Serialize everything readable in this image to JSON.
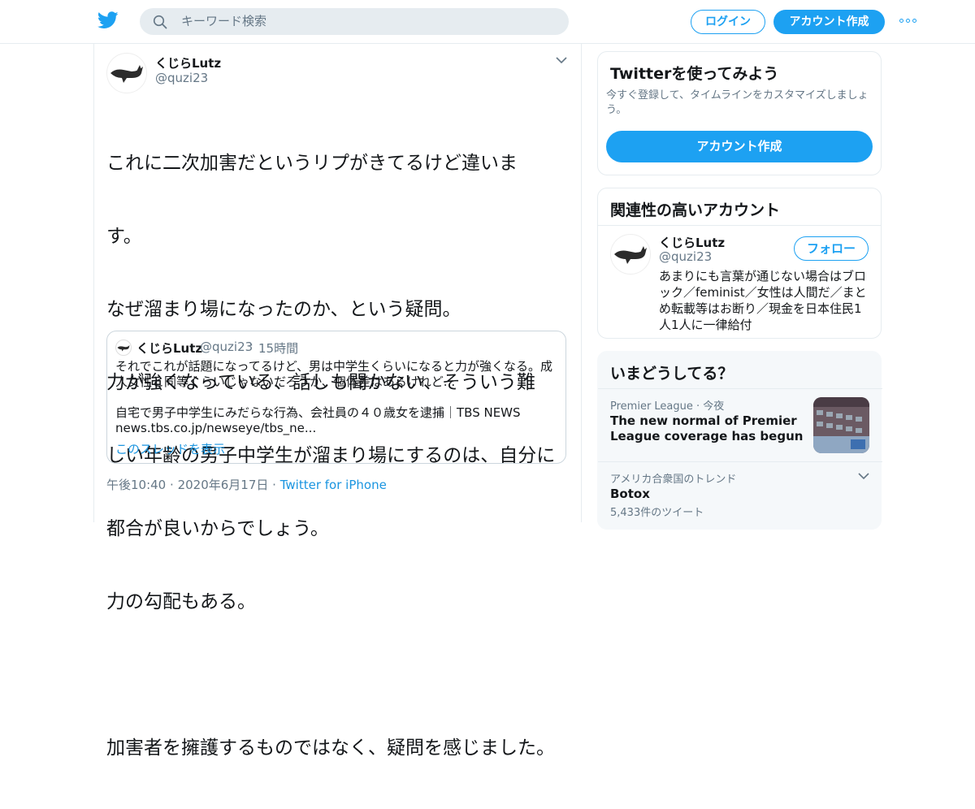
{
  "header": {
    "search_placeholder": "キーワード検索",
    "login_label": "ログイン",
    "signup_label": "アカウント作成"
  },
  "colors": {
    "brand_blue": "#1da1f2",
    "link_blue": "#1b95e0",
    "secondary_text": "#657786",
    "border": "#e6ecf0"
  },
  "tweet": {
    "author_name": "くじらLutz",
    "author_handle": "@quzi23",
    "text_lines": [
      "これに二次加害だというリプがきてるけど違いま",
      "す。",
      "なぜ溜まり場になったのか、という疑問。",
      "力が強くなっている、話しも聞かない、そういう難",
      "しい年齢の男子中学生が溜まり場にするのは、自分に",
      "都合が良いからでしょう。",
      "力の勾配もある。",
      "",
      "加害者を擁護するものではなく、疑問を感じました。"
    ],
    "quote": {
      "author_name": "くじらLutz",
      "author_handle": "@quzi23",
      "dot": "·",
      "time": "15時間",
      "text_line1": "それでこれが話題になってるけど、男は中学生くらいになると力が強くなる。成",
      "text_line2": "人女性と同等くらいじゃないだろうか、個体差はあるけれど...",
      "text_line3": "",
      "text_line4": "自宅で男子中学生にみだらな行為、会社員の４０歳女を逮捕｜TBS NEWS",
      "text_line5": "news.tbs.co.jp/newseye/tbs_ne...",
      "show_thread": "このスレッドを表示"
    },
    "meta": {
      "time": "午後10:40",
      "dot1": "·",
      "date": "2020年6月17日",
      "dot2": "·",
      "source": "Twitter for iPhone"
    }
  },
  "sidebar": {
    "signup_card": {
      "title": "Twitterを使ってみよう",
      "subtitle": "今すぐ登録して、タイムラインをカスタマイズしましょう。",
      "cta": "アカウント作成"
    },
    "related_card": {
      "title": "関連性の高いアカウント",
      "name": "くじらLutz",
      "handle": "@quzi23",
      "follow": "フォロー",
      "bio": "あまりにも言葉が通じない場合はブロック／feminist／女性は人間だ／まとめ転載等はお断り／現金を日本住民1人1人に一律給付"
    },
    "trends_card": {
      "title": "いまどうしてる？",
      "trend1_context": "Premier League · 今夜",
      "trend1_title": "The new normal of Premier League coverage has begun",
      "trend2_context": "アメリカ合衆国のトレンド",
      "trend2_title": "Botox",
      "trend2_count": "5,433件のツイート"
    }
  }
}
